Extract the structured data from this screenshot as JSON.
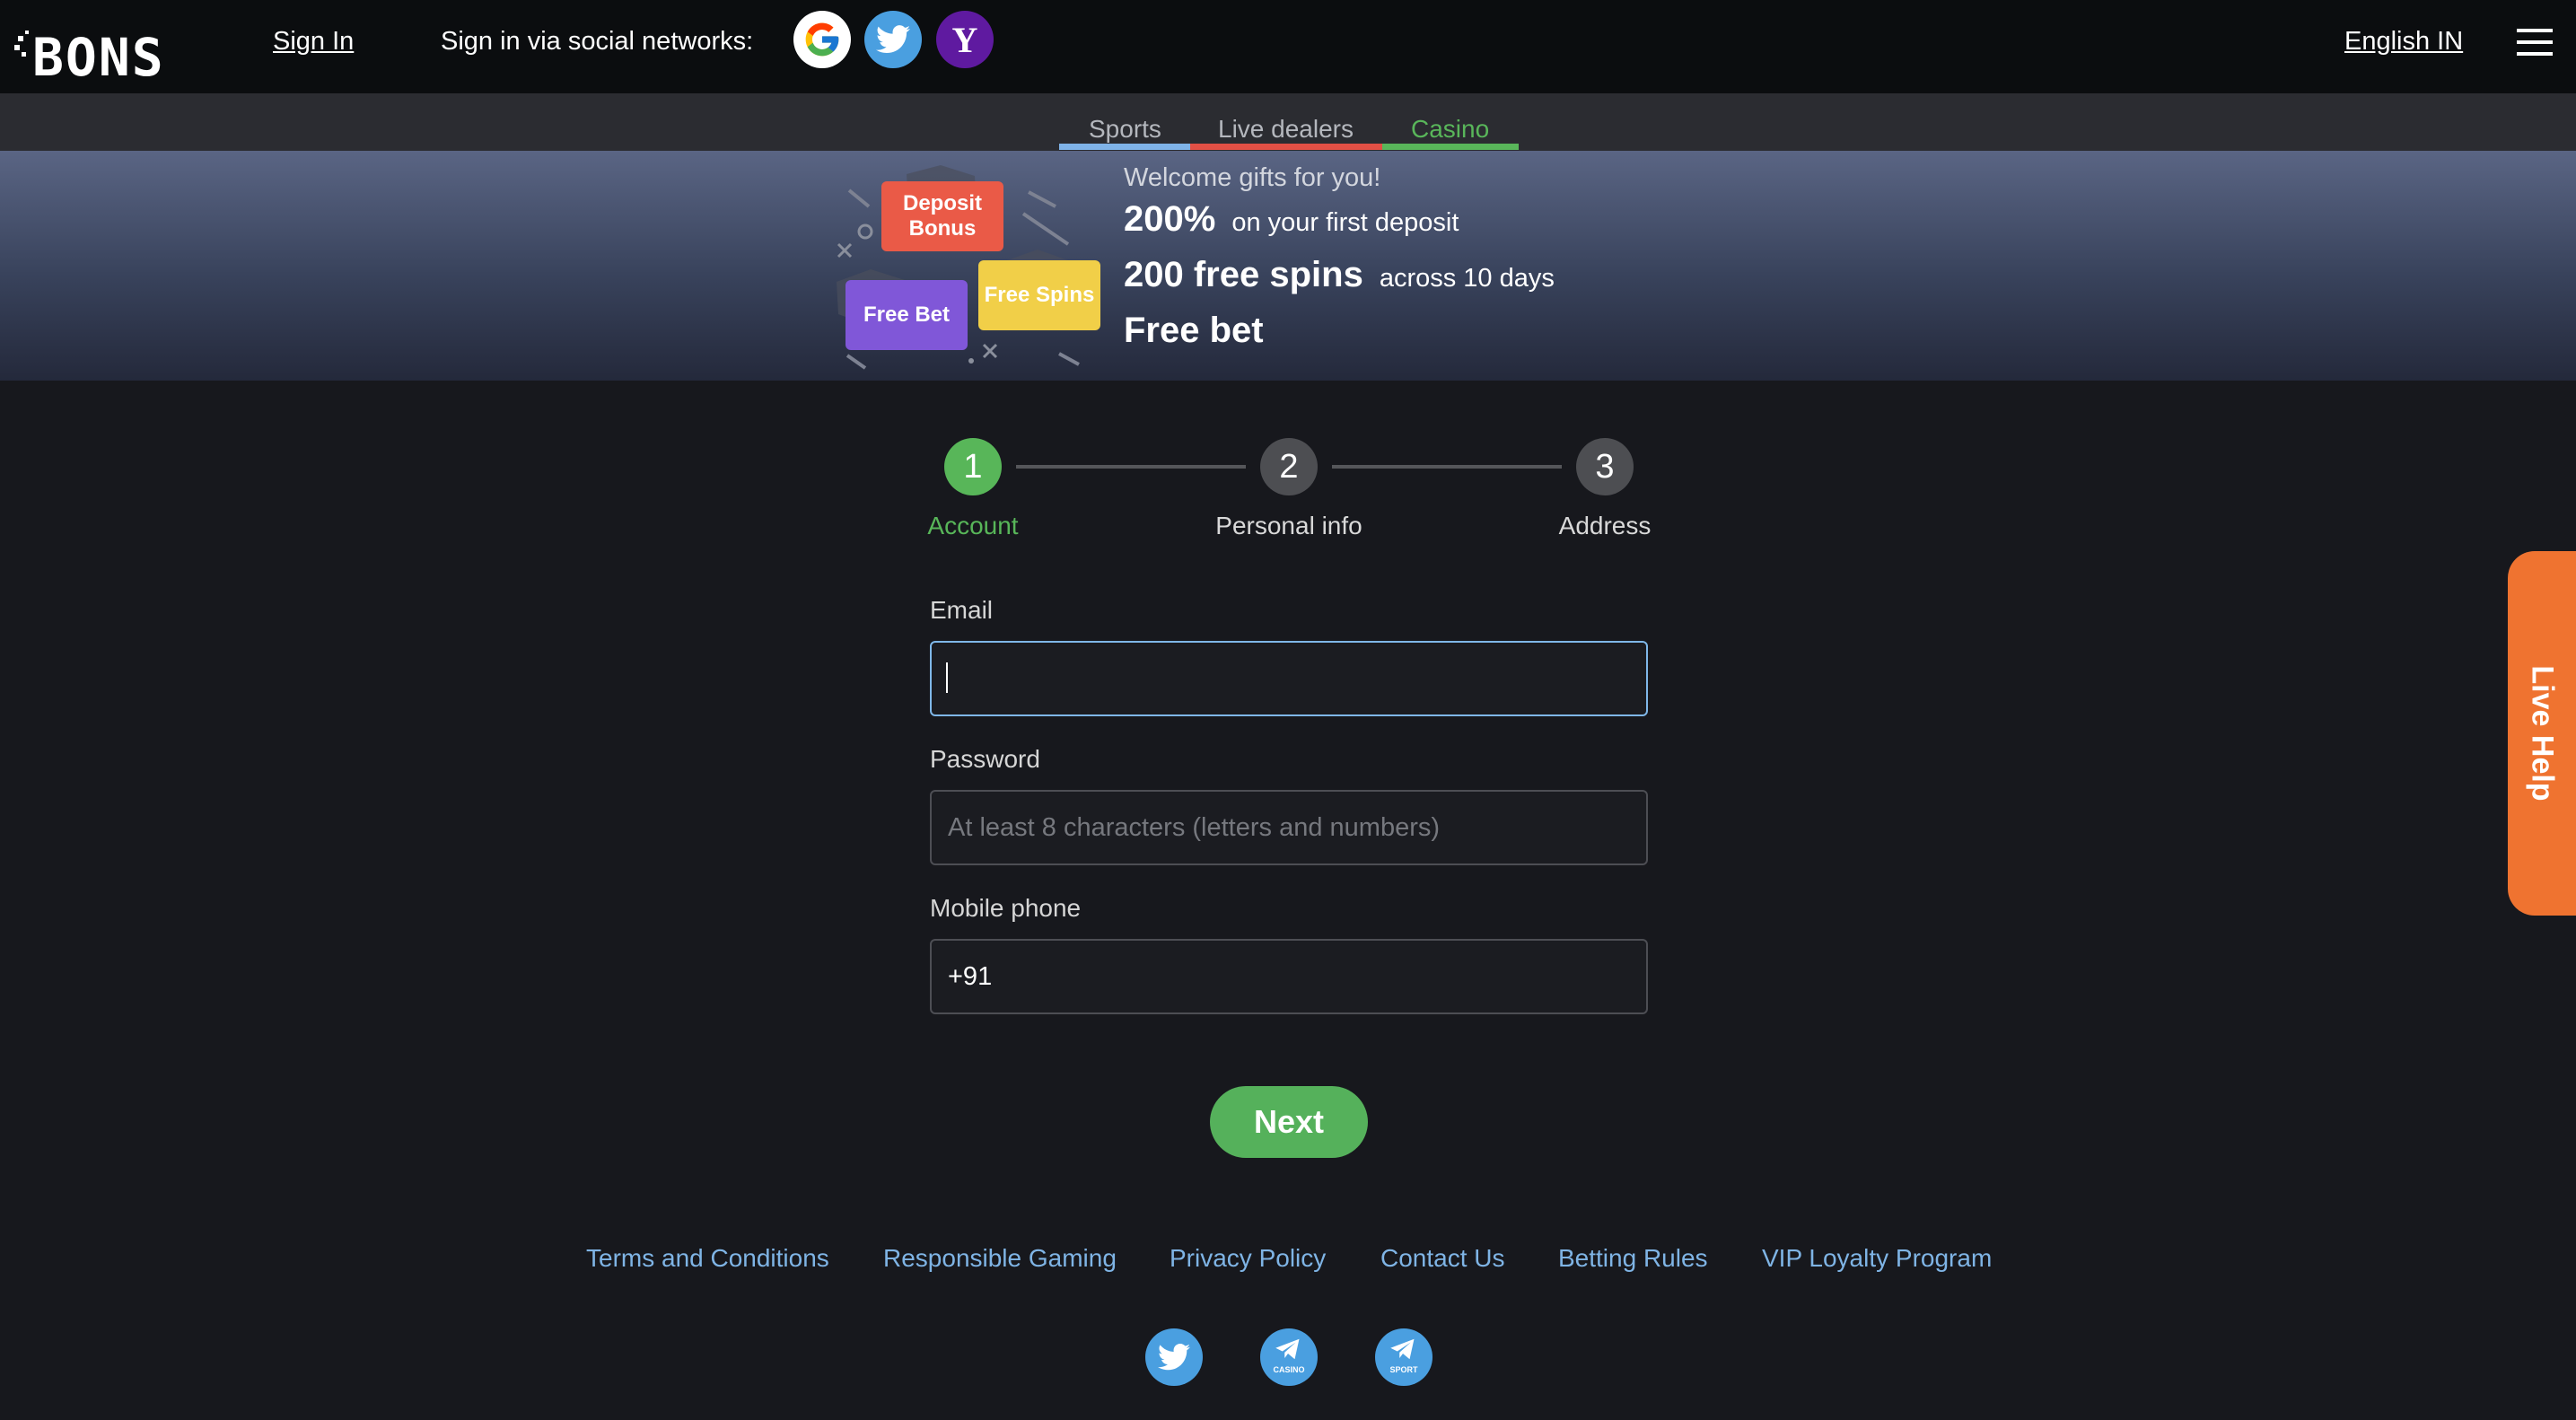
{
  "header": {
    "logo_text": "BONS",
    "signin_label": "Sign In",
    "social_label": "Sign in via social networks:",
    "social": [
      "google",
      "twitter",
      "yahoo"
    ],
    "yahoo_glyph": "Y",
    "language": "English IN"
  },
  "nav": {
    "tabs": [
      {
        "label": "Sports",
        "color": "#7fb3e8"
      },
      {
        "label": "Live dealers",
        "color": "#e25045"
      },
      {
        "label": "Casino",
        "color": "#59b65a",
        "active": true
      }
    ]
  },
  "banner": {
    "badges": {
      "deposit": "Deposit Bonus",
      "freebet": "Free Bet",
      "spins": "Free Spins"
    },
    "welcome": "Welcome gifts for you!",
    "line1_big": "200%",
    "line1_small": "on your first deposit",
    "line2_big": "200 free spins",
    "line2_small": "across 10 days",
    "line3_big": "Free bet"
  },
  "steps": [
    {
      "number": "1",
      "label": "Account",
      "active": true
    },
    {
      "number": "2",
      "label": "Personal info"
    },
    {
      "number": "3",
      "label": "Address"
    }
  ],
  "form": {
    "email_label": "Email",
    "email_value": "",
    "password_label": "Password",
    "password_placeholder": "At least 8 characters (letters and numbers)",
    "phone_label": "Mobile phone",
    "phone_value": "+91",
    "next_label": "Next"
  },
  "footer": {
    "links": [
      "Terms and Conditions",
      "Responsible Gaming",
      "Privacy Policy",
      "Contact Us",
      "Betting Rules",
      "VIP Loyalty Program"
    ],
    "social": [
      {
        "icon": "twitter-icon",
        "caption": ""
      },
      {
        "icon": "telegram-icon",
        "caption": "CASINO"
      },
      {
        "icon": "telegram-icon",
        "caption": "SPORT"
      }
    ]
  },
  "live_help": "Live Help",
  "colors": {
    "accent_green": "#58b659",
    "link_blue": "#7fb4e5",
    "live_help_orange": "#ef7330"
  }
}
